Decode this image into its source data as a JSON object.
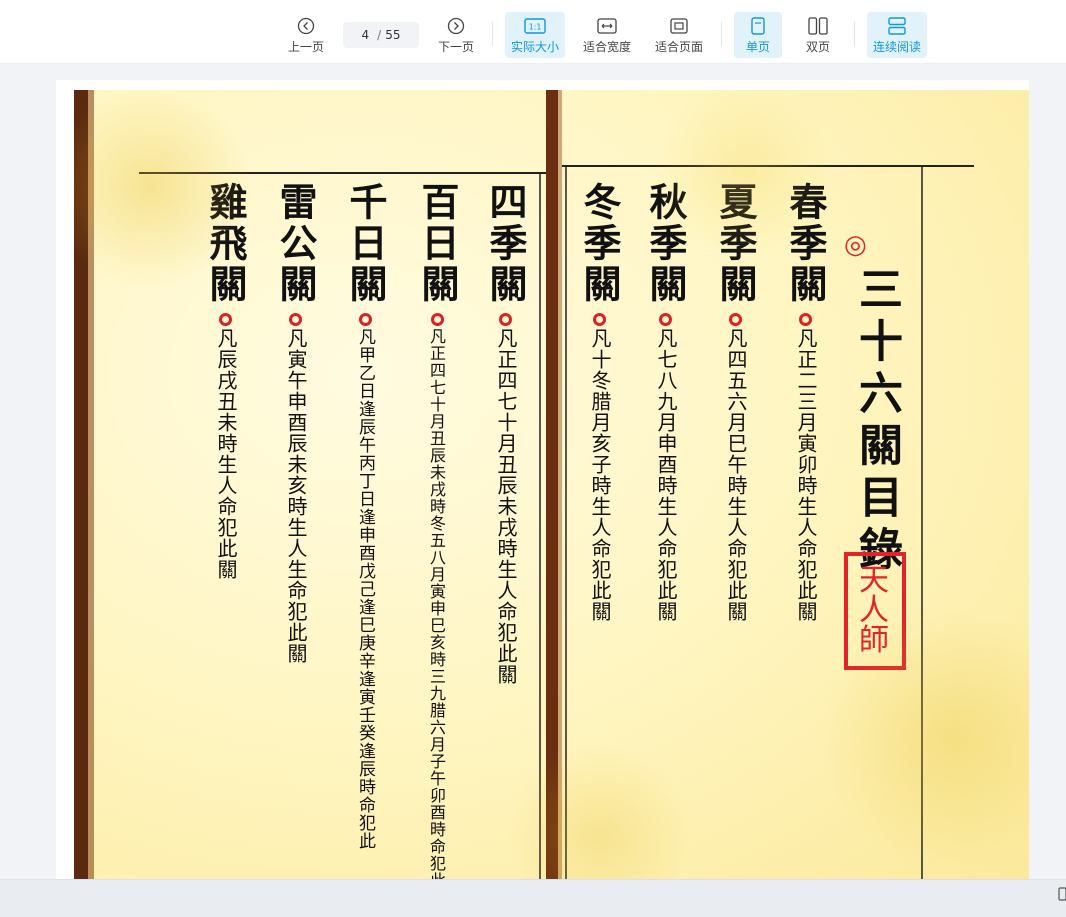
{
  "toolbar": {
    "prev_label": "上一页",
    "next_label": "下一页",
    "current_page": "4",
    "page_separator": "/",
    "total_pages": "55",
    "actual_size_label": "实际大小",
    "actual_size_icon_text": "1:1",
    "fit_width_label": "适合宽度",
    "fit_page_label": "适合页面",
    "single_page_label": "单页",
    "double_page_label": "双页",
    "continuous_label": "连续阅读",
    "accent_color": "#1296db",
    "active_bg": "#e1f2fb"
  },
  "document": {
    "title": "三十六關目錄",
    "seal_text": "天人師",
    "entries": [
      {
        "name": "春季關",
        "rule": "凡正二三月寅卯時生人命犯此關"
      },
      {
        "name": "夏季關",
        "rule": "凡四五六月巳午時生人命犯此關"
      },
      {
        "name": "秋季關",
        "rule": "凡七八九月申酉時生人命犯此關"
      },
      {
        "name": "冬季關",
        "rule": "凡十冬腊月亥子時生人命犯此關"
      },
      {
        "name": "四季關",
        "rule": "凡正四七十月丑辰未戌時生人命犯此關"
      },
      {
        "name": "百日關",
        "rule": "凡正四七十月丑辰未戌時冬五八月寅申巳亥時三九腊六月子午卯酉時命犯此"
      },
      {
        "name": "千日關",
        "rule": "凡甲乙日逢辰午丙丁日逢申酉戊己逢巳庚辛逢寅壬癸逢辰時命犯此"
      },
      {
        "name": "雷公關",
        "rule": "凡寅午申酉辰未亥時生人生命犯此關"
      },
      {
        "name": "雞飛關",
        "rule": "凡辰戌丑未時生人命犯此關"
      }
    ]
  }
}
